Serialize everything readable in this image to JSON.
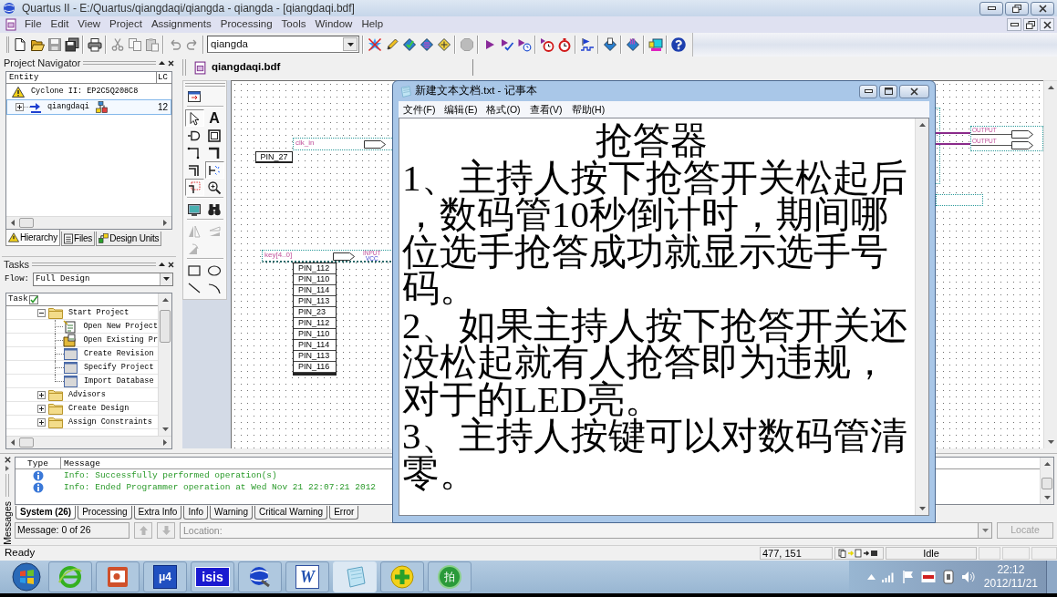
{
  "window": {
    "title": "Quartus II - E:/Quartus/qiangdaqi/qiangda - qiangda - [qiangdaqi.bdf]"
  },
  "menu": [
    "File",
    "Edit",
    "View",
    "Project",
    "Assignments",
    "Processing",
    "Tools",
    "Window",
    "Help"
  ],
  "toolbar": [
    [
      {
        "kind": "new",
        "disabled": false
      },
      {
        "kind": "open",
        "disabled": false
      },
      {
        "kind": "save",
        "disabled": true
      },
      {
        "kind": "save_all",
        "disabled": false
      }
    ],
    [
      {
        "kind": "print",
        "disabled": false
      }
    ],
    [
      {
        "kind": "cut",
        "disabled": true
      },
      {
        "kind": "copy",
        "disabled": true
      },
      {
        "kind": "paste",
        "disabled": true
      }
    ],
    [
      {
        "kind": "undo",
        "disabled": true
      },
      {
        "kind": "redo",
        "disabled": true
      }
    ],
    [
      {
        "kind": "dropdown",
        "value": "qiangda"
      }
    ],
    [
      {
        "kind": "star",
        "disabled": false
      },
      {
        "kind": "pencil",
        "disabled": false
      },
      {
        "kind": "diamond_check",
        "disabled": false
      },
      {
        "kind": "diamond_flag",
        "disabled": false
      },
      {
        "kind": "diamond_grid",
        "disabled": false
      }
    ],
    [
      {
        "kind": "stop",
        "disabled": true
      }
    ],
    [
      {
        "kind": "play",
        "disabled": false
      },
      {
        "kind": "play_check",
        "disabled": false
      },
      {
        "kind": "play_clock",
        "disabled": false
      }
    ],
    [
      {
        "kind": "timer_play",
        "disabled": false
      },
      {
        "kind": "timer",
        "disabled": false
      }
    ],
    [
      {
        "kind": "flag_wave",
        "disabled": false
      }
    ],
    [
      {
        "kind": "diamond_doc",
        "disabled": false
      }
    ],
    [
      {
        "kind": "diamond_chip",
        "disabled": false
      }
    ],
    [
      {
        "kind": "chip",
        "disabled": false
      }
    ],
    [
      {
        "kind": "help",
        "disabled": false
      }
    ]
  ],
  "project_navigator": {
    "title": "Project Navigator",
    "columns": [
      "Entity",
      "LC"
    ],
    "rows": [
      {
        "kind": "device",
        "entity": "Cyclone II: EP2C5Q208C8",
        "selected": false
      },
      {
        "kind": "design",
        "entity": "qiangdaqi",
        "lc": "12",
        "selected": true,
        "expanded": false
      }
    ],
    "tabs": [
      {
        "kind": "hierarchy",
        "label": "Hierarchy",
        "selected": true
      },
      {
        "kind": "files",
        "label": "Files",
        "selected": false
      },
      {
        "kind": "units",
        "label": "Design Units",
        "selected": false
      }
    ]
  },
  "tasks": {
    "title": "Tasks",
    "flow_label": "Flow:",
    "flow": "Full Design",
    "column": "Task",
    "items": [
      {
        "label": "Start Project",
        "expanded": true,
        "children": [
          {
            "kind": "wizard",
            "label": "Open New Project"
          },
          {
            "kind": "open",
            "label": "Open Existing Pr"
          },
          {
            "kind": "dialog",
            "label": "Create Revision"
          },
          {
            "kind": "dialog",
            "label": "Specify Project"
          },
          {
            "kind": "dialog",
            "label": "Import Database"
          }
        ]
      },
      {
        "label": "Advisors",
        "expanded": false
      },
      {
        "label": "Create Design",
        "expanded": false
      },
      {
        "label": "Assign Constraints",
        "expanded": false
      }
    ]
  },
  "editor_tabs": [
    {
      "label": "qiangdaqi.bdf",
      "selected": true
    }
  ],
  "drawing_tools": [
    [
      {
        "kind": "window",
        "on": false,
        "disabled": false
      }
    ],
    [
      {
        "kind": "select",
        "on": true,
        "disabled": false
      },
      {
        "kind": "text",
        "glyph": "A",
        "on": false,
        "disabled": false
      },
      {
        "kind": "symbol",
        "on": false,
        "disabled": false
      },
      {
        "kind": "block",
        "on": false,
        "disabled": false
      },
      {
        "kind": "node",
        "on": false,
        "disabled": false
      },
      {
        "kind": "bus",
        "on": false,
        "disabled": false
      },
      {
        "kind": "conduit",
        "on": false,
        "disabled": false
      },
      {
        "kind": "partial",
        "on": true,
        "disabled": false
      },
      {
        "kind": "rubber",
        "on": true,
        "disabled": false
      },
      {
        "kind": "zoom",
        "on": false,
        "disabled": false
      }
    ],
    [
      {
        "kind": "fullscreen",
        "on": false,
        "disabled": false
      },
      {
        "kind": "find",
        "on": false,
        "disabled": false
      }
    ],
    [
      {
        "kind": "flip_h",
        "on": false,
        "disabled": true
      },
      {
        "kind": "flip_v",
        "on": false,
        "disabled": true
      },
      {
        "kind": "rotate",
        "on": false,
        "disabled": true
      }
    ],
    [
      {
        "kind": "rect",
        "on": false,
        "disabled": false
      },
      {
        "kind": "ellipse",
        "on": false,
        "disabled": false
      },
      {
        "kind": "line",
        "on": false,
        "disabled": false
      },
      {
        "kind": "arc",
        "on": false,
        "disabled": false
      }
    ]
  ],
  "schematic": {
    "clock_pin": {
      "name": "clk_in",
      "locations": [
        "PIN_27"
      ]
    },
    "key_pin": {
      "name": "key[4..0]",
      "type_label": "INPUT",
      "default": "VCC",
      "locations": [
        "PIN_112",
        "PIN_110",
        "PIN_114",
        "PIN_113",
        "PIN_23",
        "PIN_112",
        "PIN_110",
        "PIN_114",
        "PIN_113",
        "PIN_116"
      ]
    },
    "output_pins": [
      {
        "type_label": "OUTPUT"
      },
      {
        "type_label": "OUTPUT"
      }
    ]
  },
  "notepad": {
    "title": "新建文本文档.txt - 记事本",
    "menu": [
      "文件(F)",
      "编辑(E)",
      "格式(O)",
      "查看(V)",
      "帮助(H)"
    ],
    "lines": [
      {
        "kind": "indented",
        "text": "抢答器"
      },
      {
        "kind": "plain",
        "text": "1、主持人按下抢答开关松起后"
      },
      {
        "kind": "plain",
        "text": "，数码管10秒倒计时，期间哪"
      },
      {
        "kind": "plain",
        "text": "位选手抢答成功就显示选手号"
      },
      {
        "kind": "plain",
        "text": "码。"
      },
      {
        "kind": "plain",
        "text": "2、如果主持人按下抢答开关还"
      },
      {
        "kind": "plain",
        "text": "没松起就有人抢答即为违规，"
      },
      {
        "kind": "plain",
        "text": "对于的LED亮。"
      },
      {
        "kind": "plain",
        "text": "3、主持人按键可以对数码管清"
      },
      {
        "kind": "plain",
        "text": "零。"
      }
    ]
  },
  "messages": {
    "side_label": "Messages",
    "columns": [
      "Type",
      "Message"
    ],
    "rows": [
      {
        "kind": "info",
        "text": "Info: Successfully performed operation(s)"
      },
      {
        "kind": "info",
        "text": "Info: Ended Programmer operation at Wed Nov 21 22:07:21 2012"
      }
    ],
    "tabs": [
      {
        "label": "System (26)",
        "selected": true
      },
      {
        "label": "Processing",
        "selected": false
      },
      {
        "label": "Extra Info",
        "selected": false
      },
      {
        "label": "Info",
        "selected": false
      },
      {
        "label": "Warning",
        "selected": false
      },
      {
        "label": "Critical Warning",
        "selected": false
      },
      {
        "label": "Error",
        "selected": false
      }
    ],
    "counter": "Message: 0 of 26",
    "nav_buttons": [
      {
        "kind": "up",
        "disabled": true
      },
      {
        "kind": "down",
        "disabled": true
      }
    ],
    "location": {
      "placeholder": "Location:"
    },
    "locate_button": {
      "label": "Locate",
      "disabled": true
    }
  },
  "status_bar": {
    "message": "Ready",
    "coordinates": "477, 151",
    "state": "Idle"
  },
  "taskbar": {
    "items": [
      {
        "kind": "browser",
        "selected": false
      },
      {
        "kind": "presentation",
        "selected": false
      },
      {
        "kind": "ide",
        "glyph": "μ4",
        "selected": false
      },
      {
        "kind": "schematic",
        "glyph": "isis",
        "selected": false
      },
      {
        "kind": "quartus",
        "selected": false
      },
      {
        "kind": "word",
        "glyph": "W",
        "selected": false
      },
      {
        "kind": "notepad",
        "selected": true
      },
      {
        "kind": "security",
        "selected": false
      },
      {
        "kind": "capture",
        "glyph": "拍",
        "selected": false
      }
    ],
    "clock": {
      "time": "22:12",
      "date": "2012/11/21"
    }
  }
}
